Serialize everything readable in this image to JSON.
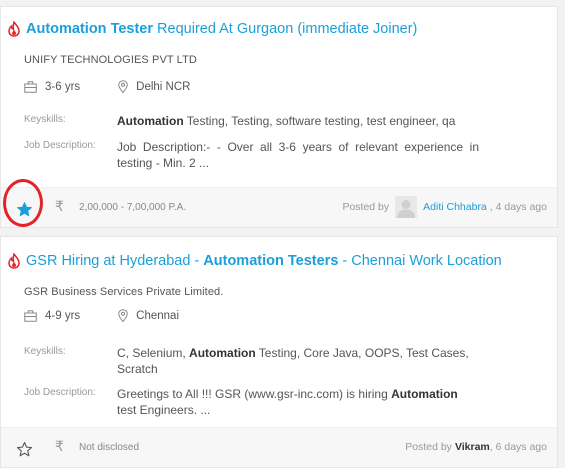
{
  "jobs": [
    {
      "title_bold": "Automation Tester",
      "title_rest": " Required At Gurgaon (immediate Joiner)",
      "company": "UNIFY TECHNOLOGIES PVT LTD",
      "experience": "3-6 yrs",
      "location": "Delhi NCR",
      "keyskills_label": "Keyskills:",
      "keyskills_bold": "Automation",
      "keyskills_rest": " Testing, Testing, software testing, test engineer, qa",
      "desc_label": "Job Description:",
      "desc_text": "Job Description:- - Over all 3-6 years of relevant experience in testing - Min. 2 ...",
      "salary": "2,00,000 - 7,00,000 P.A.",
      "posted_label": "Posted by",
      "poster": "Aditi Chhabra",
      "ago": ", 4 days ago",
      "starred": true
    },
    {
      "title_a": "GSR Hiring at Hyderabad - ",
      "title_bold": "Automation Testers",
      "title_c": " - Chennai Work Location",
      "company": "GSR Business Services Private Limited.",
      "experience": "4-9 yrs",
      "location": "Chennai",
      "keyskills_label": "Keyskills:",
      "keyskills_a": "C, Selenium, ",
      "keyskills_bold": "Automation",
      "keyskills_rest": " Testing, Core Java, OOPS, Test Cases, Scratch",
      "desc_label": "Job Description:",
      "desc_a": "Greetings to All !!! GSR (www.gsr-inc.com) is hiring ",
      "desc_bold": "Automation",
      "desc_rest": " test Engineers. ...",
      "salary": "Not disclosed",
      "posted_label": "Posted by",
      "poster": "Vikram",
      "ago": ", 6 days ago",
      "starred": false
    }
  ],
  "colors": {
    "link": "#1a9fd9",
    "star_active": "#1a9fd9",
    "fire": "#e3232b",
    "highlight": "#e3232b"
  },
  "icons": [
    "fire-icon",
    "briefcase-icon",
    "location-icon",
    "star-icon",
    "rupee-icon",
    "avatar-icon"
  ]
}
